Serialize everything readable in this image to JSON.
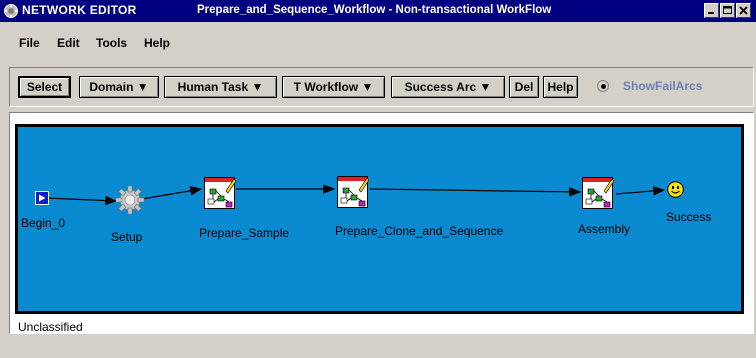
{
  "window": {
    "app_name": "NETWORK EDITOR",
    "title": "Prepare_and_Sequence_Workflow - Non-transactional WorkFlow",
    "controls": [
      "minimize-icon",
      "maximize-icon",
      "close-icon"
    ]
  },
  "menu": {
    "items": [
      {
        "label": "File"
      },
      {
        "label": "Edit"
      },
      {
        "label": "Tools"
      },
      {
        "label": "Help"
      }
    ]
  },
  "toolbar": {
    "select_label": "Select",
    "domain_label": "Domain ▼",
    "human_task_label": "Human Task ▼",
    "t_workflow_label": "T Workflow ▼",
    "success_arc_label": "Success Arc ▼",
    "del_label": "Del",
    "help_label": "Help",
    "show_fail_arcs_label": "ShowFailArcs",
    "show_fail_arcs_checked": true
  },
  "canvas": {
    "background": "#0a8ad0",
    "nodes": [
      {
        "id": "begin",
        "label": "Begin_0",
        "icon": "begin-play-icon"
      },
      {
        "id": "setup",
        "label": "Setup",
        "icon": "gear-icon"
      },
      {
        "id": "prepare_sample",
        "label": "Prepare_Sample",
        "icon": "task-workflow-icon"
      },
      {
        "id": "prepare_clone",
        "label": "Prepare_Clone_and_Sequence",
        "icon": "task-workflow-icon"
      },
      {
        "id": "assembly",
        "label": "Assembly",
        "icon": "task-workflow-icon"
      },
      {
        "id": "success",
        "label": "Success",
        "icon": "smiley-icon"
      }
    ]
  },
  "status": {
    "classification": "Unclassified"
  }
}
